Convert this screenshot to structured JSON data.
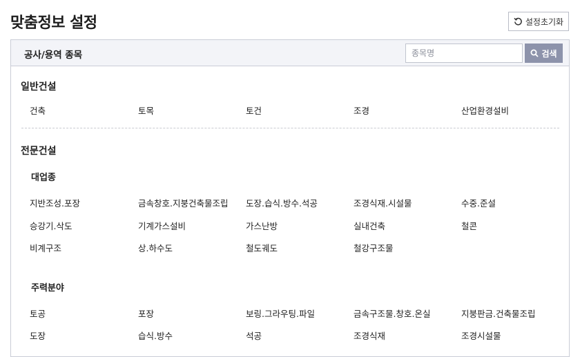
{
  "page": {
    "title": "맞춤정보 설정"
  },
  "reset_button": {
    "label": "설정초기화",
    "icon": "reset-icon"
  },
  "panel": {
    "title": "공사/용역 종목",
    "search": {
      "placeholder": "종목명",
      "value": "",
      "button_label": "검색",
      "icon": "search-icon"
    }
  },
  "general": {
    "title": "일반건설",
    "items": [
      "건축",
      "토목",
      "토건",
      "조경",
      "산업환경설비"
    ]
  },
  "specialty": {
    "title": "전문건설",
    "major": {
      "title": "대업종",
      "rows": [
        [
          "지반조성.포장",
          "금속창호.지붕건축물조립",
          "도장.습식.방수.석공",
          "조경식재.시설물",
          "수중.준설"
        ],
        [
          "승강기.삭도",
          "기계가스설비",
          "가스난방",
          "실내건축",
          "철콘"
        ],
        [
          "비계구조",
          "상.하수도",
          "철도궤도",
          "철강구조물"
        ]
      ]
    },
    "main": {
      "title": "주력분야",
      "rows": [
        [
          "토공",
          "포장",
          "보링.그라우팅.파일",
          "금속구조물.창호.온실",
          "지붕판금.건축물조립"
        ],
        [
          "도장",
          "습식.방수",
          "석공",
          "조경식재",
          "조경시설물"
        ]
      ]
    }
  },
  "colors": {
    "header_bg": "#f3f4f8",
    "search_button": "#8d93ab",
    "border": "#c9ccd6"
  }
}
